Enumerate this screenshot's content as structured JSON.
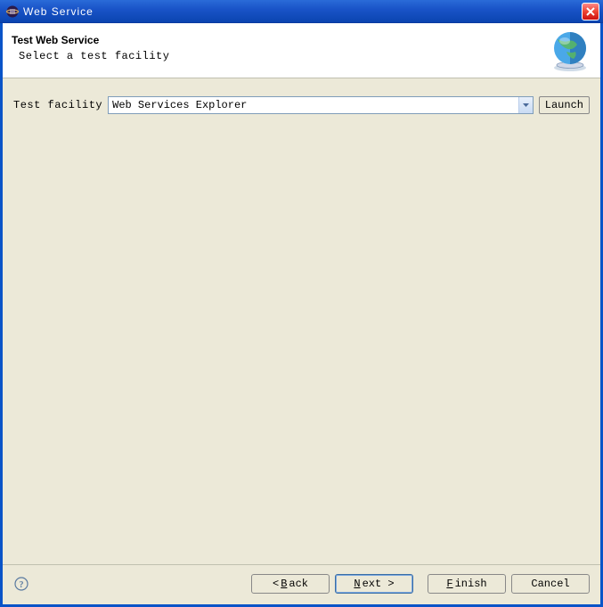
{
  "window": {
    "title": "Web Service"
  },
  "header": {
    "title": "Test Web Service",
    "subtitle": "Select a test facility"
  },
  "form": {
    "test_facility_label": "Test facility",
    "dropdown_value": "Web Services Explorer",
    "launch_label": "Launch"
  },
  "footer": {
    "back_prefix": "< ",
    "back_u": "B",
    "back_rest": "ack",
    "next_u": "N",
    "next_rest": "ext >",
    "finish_u": "F",
    "finish_rest": "inish",
    "cancel": "Cancel"
  }
}
